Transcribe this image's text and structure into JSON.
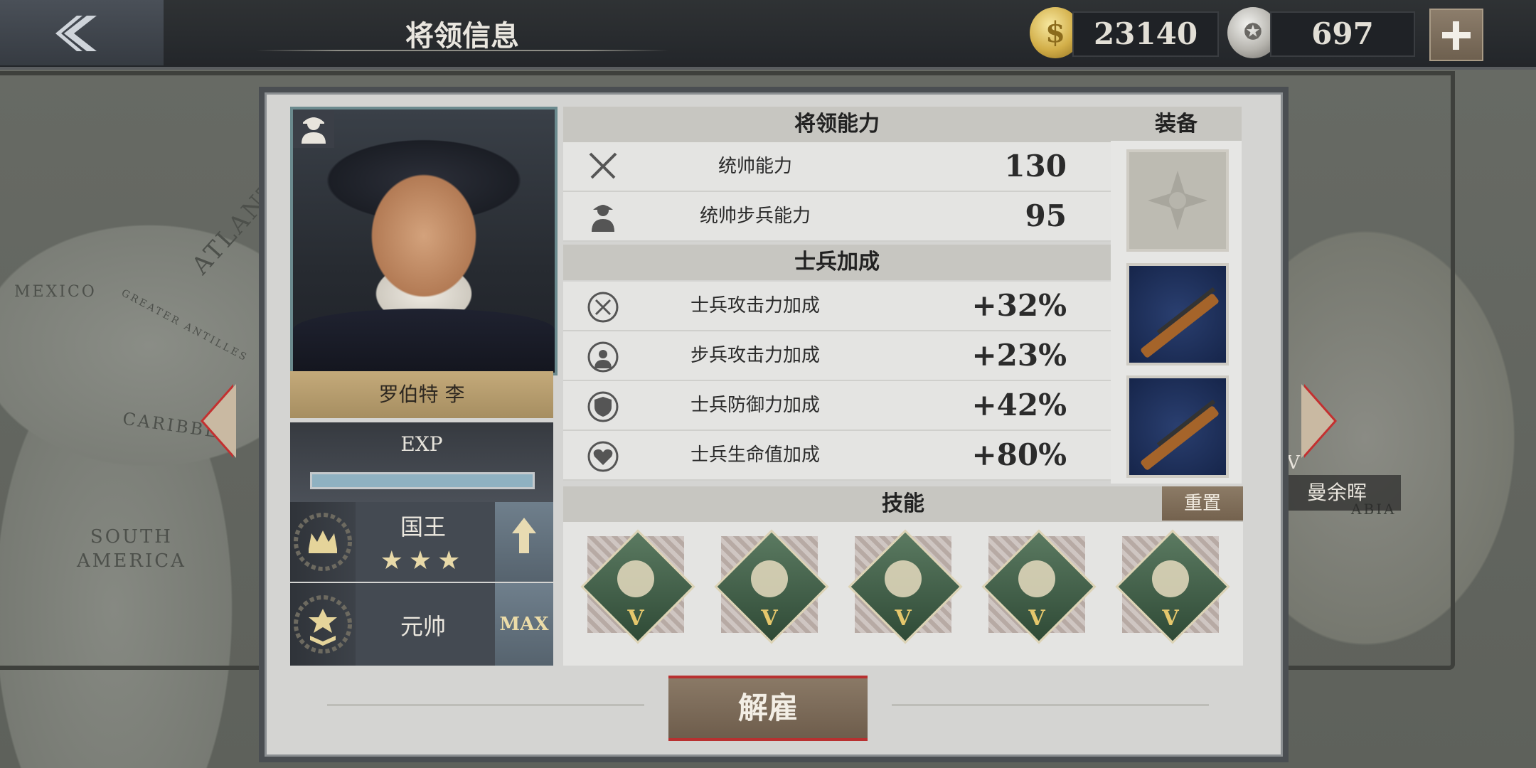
{
  "header": {
    "title": "将领信息",
    "gold_amount": "23140",
    "medal_amount": "697"
  },
  "map_labels": {
    "mexico": "MEXICO",
    "south_america": "SOUTH\nAMERICA",
    "atlantic": "ATLANT",
    "caribbean": "CARIBBE",
    "greater_antilles": "GREATER ANTILLES",
    "arabia": "ABIA"
  },
  "side_preview": {
    "roman": "IV",
    "name": "曼余晖"
  },
  "general": {
    "name": "罗伯特 李",
    "exp_label": "EXP",
    "exp_progress": 1.0,
    "rank1": {
      "title": "国王",
      "stars": "★★★"
    },
    "rank2": {
      "title": "元帅",
      "side_label": "MAX"
    }
  },
  "abilities": {
    "header": "将领能力",
    "rows": [
      {
        "label": "统帅能力",
        "value": "130",
        "icon": "crossed-swords-icon"
      },
      {
        "label": "统帅步兵能力",
        "value": "95",
        "icon": "infantry-icon"
      }
    ]
  },
  "bonuses": {
    "header": "士兵加成",
    "rows": [
      {
        "label": "士兵攻击力加成",
        "value": "+32%",
        "icon": "attack-plus-icon"
      },
      {
        "label": "步兵攻击力加成",
        "value": "+23%",
        "icon": "infantry-plus-icon"
      },
      {
        "label": "士兵防御力加成",
        "value": "+42%",
        "icon": "shield-plus-icon"
      },
      {
        "label": "士兵生命值加成",
        "value": "+80%",
        "icon": "heart-plus-icon"
      }
    ]
  },
  "equipment": {
    "header": "装备",
    "slots": [
      "medal-slot",
      "rifle-slot",
      "rifle-slot"
    ]
  },
  "skills": {
    "header": "技能",
    "reset_label": "重置",
    "items": [
      {
        "icon": "running-soldier-icon",
        "level": "V"
      },
      {
        "icon": "marching-squad-icon",
        "level": "V"
      },
      {
        "icon": "shield-soldier-icon",
        "level": "V"
      },
      {
        "icon": "rifleman-trench-icon",
        "level": "V"
      },
      {
        "icon": "crawling-soldier-icon",
        "level": "V"
      }
    ]
  },
  "dismiss_label": "解雇",
  "colors": {
    "panel_bg": "#d4d4d2",
    "topbar_bg": "#23262a",
    "accent_gold": "#c4aa7a",
    "skill_green": "#2f4a36",
    "dismiss_red": "#b83030"
  }
}
